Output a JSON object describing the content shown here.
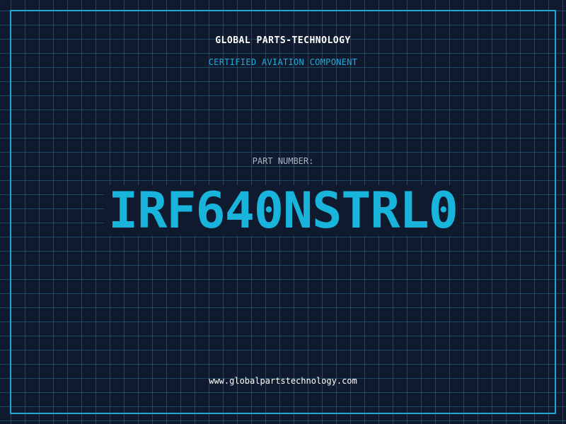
{
  "header": {
    "company": "GLOBAL PARTS-TECHNOLOGY",
    "subtitle": "CERTIFIED AVIATION COMPONENT"
  },
  "part": {
    "label": "PART NUMBER:",
    "number": "IRF640NSTRL0"
  },
  "footer": {
    "url": "www.globalpartstechnology.com"
  },
  "colors": {
    "background": "#101a2e",
    "grid": "#286e8c",
    "accent": "#19b4dc",
    "frame": "#22a6d6",
    "label": "#a8b3c2",
    "text": "#ffffff"
  }
}
